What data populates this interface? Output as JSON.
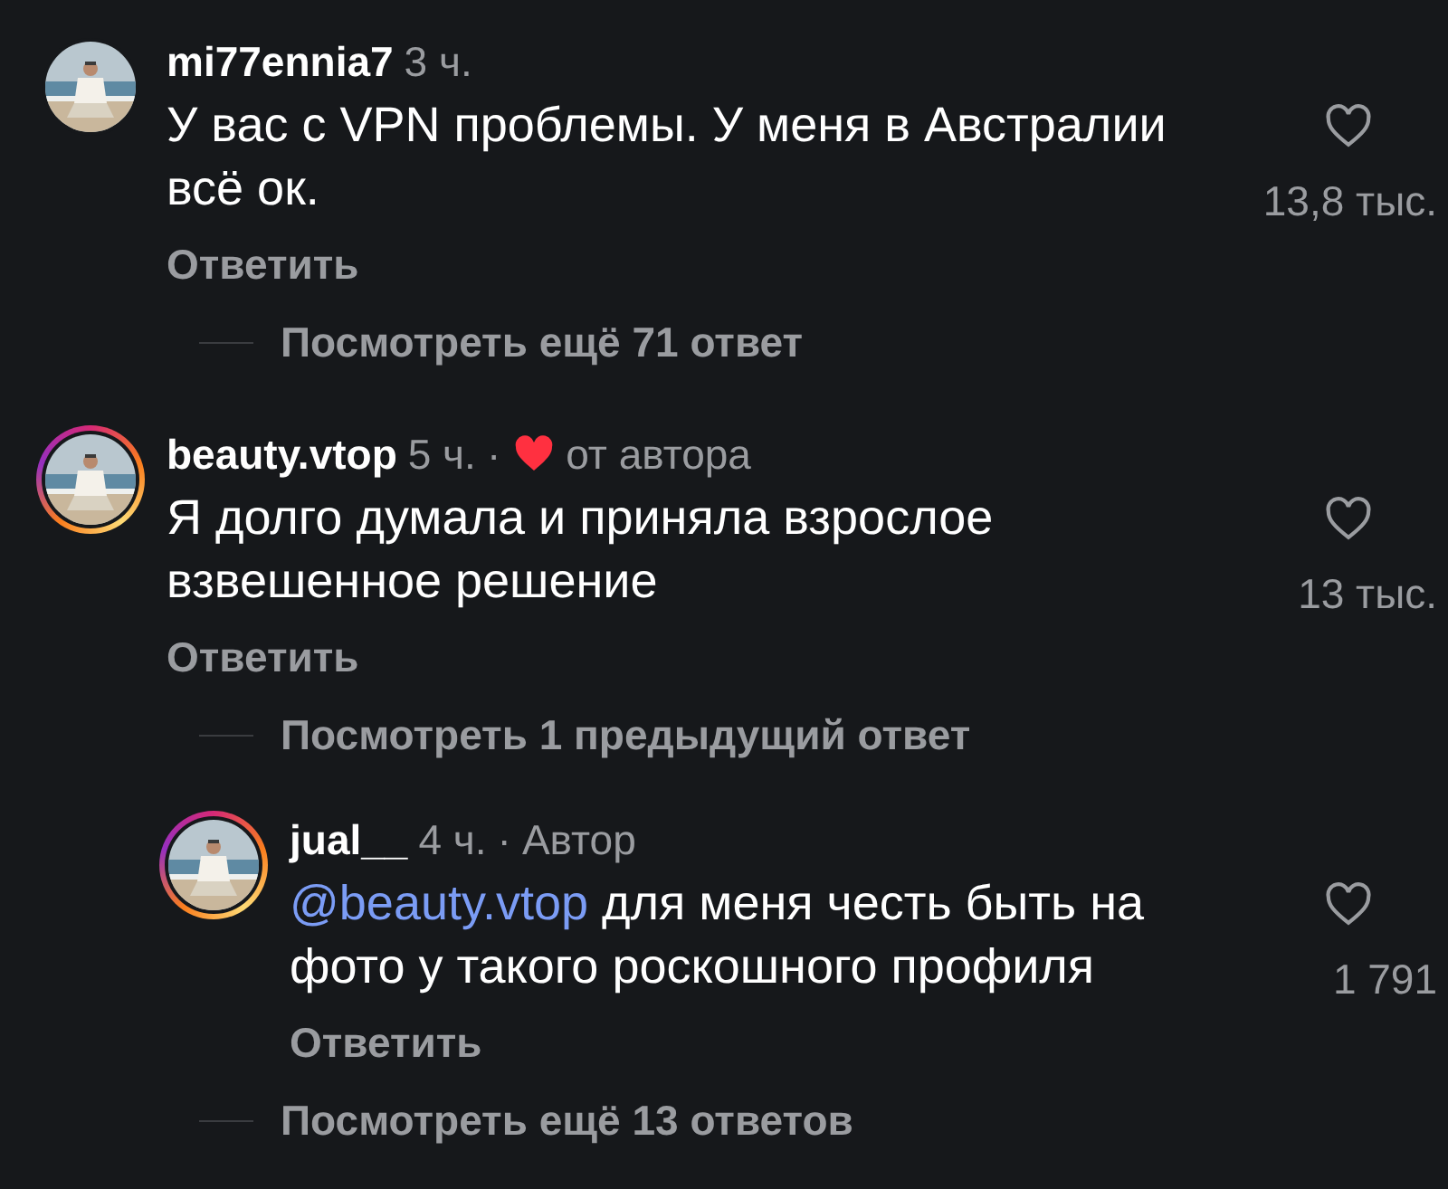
{
  "comments": [
    {
      "username": "mi77ennia7",
      "time": "3 ч.",
      "story_ring": false,
      "text": "У вас с VPN проблемы. У меня в Австралии всё ок.",
      "likes": "13,8 тыс.",
      "liked": false,
      "reply_label": "Ответить",
      "more_replies": "Посмотреть ещё 71 ответ"
    },
    {
      "username": "beauty.vtop",
      "time": "5 ч.",
      "story_ring": true,
      "badge": {
        "kind": "liked_by_author",
        "dot": "·",
        "label": "от автора"
      },
      "text": "Я долго думала и приняла взрослое взвешенное решение",
      "likes": "13 тыс.",
      "liked": false,
      "reply_label": "Ответить",
      "previous_replies": "Посмотреть 1 предыдущий ответ",
      "children": [
        {
          "username": "jual__",
          "time": "4 ч.",
          "story_ring": true,
          "badge": {
            "kind": "author",
            "dot": "·",
            "label": "Автор"
          },
          "mention": "@beauty.vtop",
          "text": "для меня честь быть на фото у такого роскошного профиля",
          "likes": "1 791",
          "liked": false,
          "reply_label": "Ответить"
        }
      ],
      "more_replies": "Посмотреть ещё 13 ответов"
    }
  ]
}
